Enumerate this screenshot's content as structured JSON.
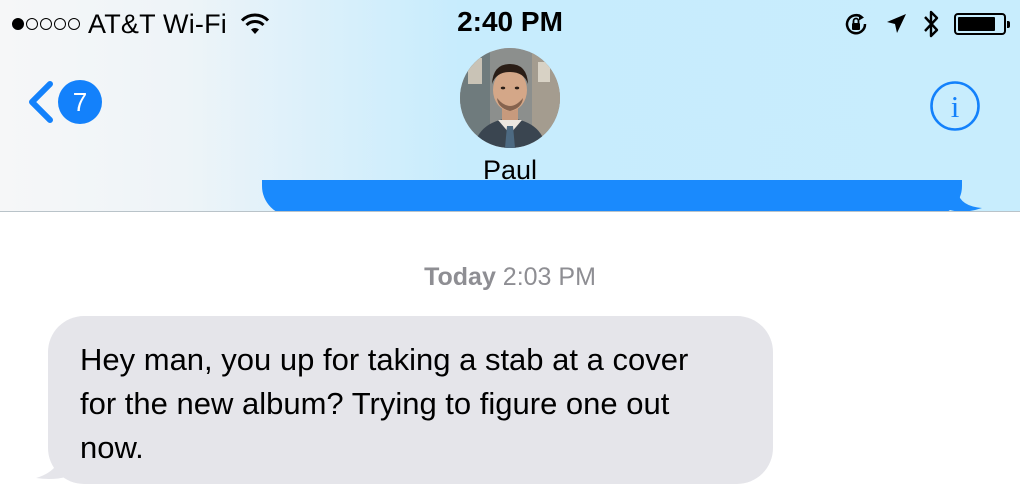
{
  "status_bar": {
    "signal_dots_filled": 1,
    "signal_dots_total": 5,
    "carrier": "AT&T Wi-Fi",
    "time": "2:40 PM",
    "battery_level": 0.85,
    "icons": [
      "wifi-icon",
      "orientation-lock-icon",
      "location-arrow-icon",
      "bluetooth-icon",
      "battery-icon"
    ]
  },
  "nav": {
    "back_badge": "7",
    "contact_name": "Paul",
    "back_icon": "chevron-left-icon",
    "info_icon": "info-icon",
    "accent_color": "#1381fb"
  },
  "conversation": {
    "timestamp_day": "Today",
    "timestamp_time": "2:03 PM",
    "messages": [
      {
        "direction": "incoming",
        "text": "Hey man, you up for taking a stab at a cover for the new album? Trying to figure one out now."
      }
    ]
  },
  "colors": {
    "header_bg": "#c8edfd",
    "incoming_bubble": "#e5e5ea",
    "outgoing_bubble": "#1a8afd",
    "timestamp": "#8e8e93"
  }
}
